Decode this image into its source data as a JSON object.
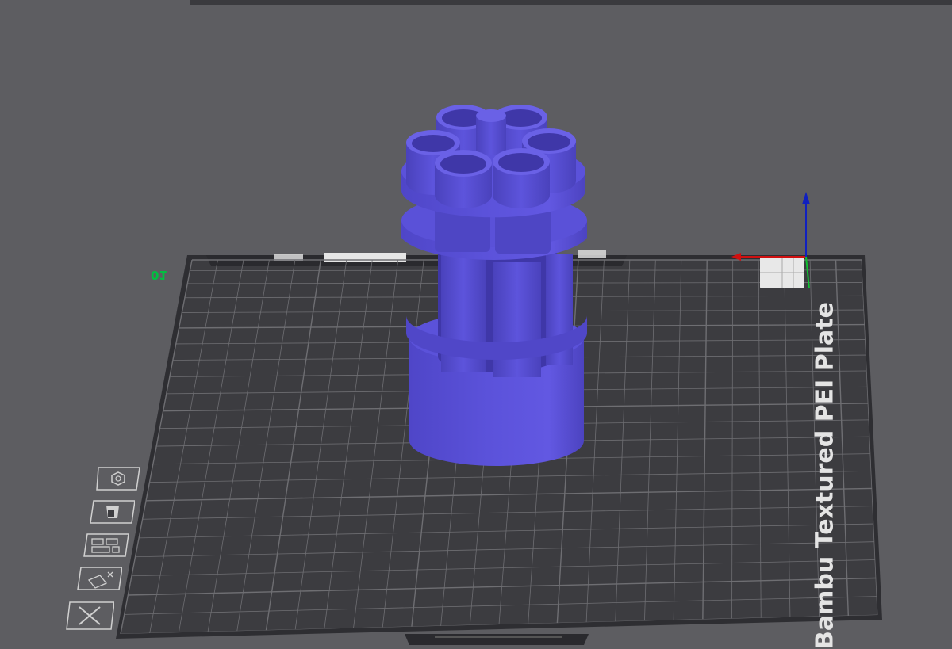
{
  "viewport": {
    "plate_name": "Bambu Textured PEI Plate",
    "plate_number": "01",
    "model_color": "#5a50d8",
    "model_shade": "#4a41b8",
    "model_light": "#6c63e6",
    "plate_color": "#3c3c40",
    "grid_color": "#6e6e72",
    "background_color": "#5d5d61"
  },
  "plate_toolbar": {
    "icons": [
      "hexagon-icon",
      "bed-type-icon",
      "arrange-icon",
      "auto-orient-icon",
      "delete-plate-icon"
    ]
  },
  "axis_gizmo": {
    "x_color": "#d01010",
    "y_color": "#10c030",
    "z_color": "#1020c0"
  }
}
